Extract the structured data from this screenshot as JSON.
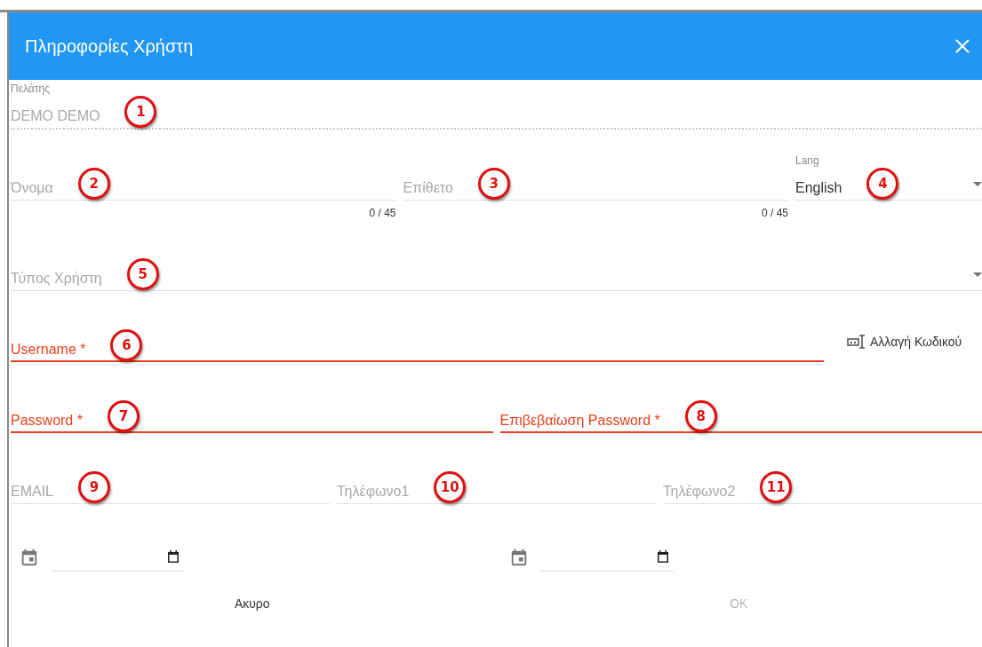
{
  "dialog": {
    "title": "Πληροφορίες Χρήστη"
  },
  "rows": [
    {
      "fields": [
        {
          "kind": "readonly",
          "label": "Πελάτης",
          "value": "DEMO DEMO",
          "callout": "1"
        }
      ]
    },
    {
      "fields": [
        {
          "kind": "text",
          "placeholder": "Όνομα",
          "counter": "0 / 45",
          "callout": "2"
        },
        {
          "kind": "text",
          "placeholder": "Επίθετο",
          "counter": "0 / 45",
          "callout": "3"
        },
        {
          "kind": "select",
          "label": "Lang",
          "value": "English",
          "callout": "4"
        }
      ]
    },
    {
      "fields": [
        {
          "kind": "select",
          "placeholder": "Τύπος Χρήστη",
          "callout": "5"
        }
      ]
    },
    {
      "fields": [
        {
          "kind": "error",
          "label": "Username *",
          "callout": "6"
        },
        {
          "kind": "action",
          "label": "Αλλαγή Κωδικού"
        }
      ]
    },
    {
      "fields": [
        {
          "kind": "error",
          "label": "Password *",
          "callout": "7"
        },
        {
          "kind": "error",
          "label": "Επιβεβαίωση Password *",
          "callout": "8"
        }
      ]
    },
    {
      "fields": [
        {
          "kind": "text",
          "placeholder": "EMAIL",
          "callout": "9"
        },
        {
          "kind": "text",
          "placeholder": "Τηλέφωνο1",
          "callout": "10"
        },
        {
          "kind": "text",
          "placeholder": "Τηλέφωνο2",
          "callout": "11"
        }
      ]
    },
    {
      "fields": [
        {
          "kind": "date"
        },
        {
          "kind": "date"
        }
      ]
    }
  ],
  "buttons": [
    {
      "label": "Ακυρο",
      "disabled": false
    },
    {
      "label": "OK",
      "disabled": true
    }
  ]
}
